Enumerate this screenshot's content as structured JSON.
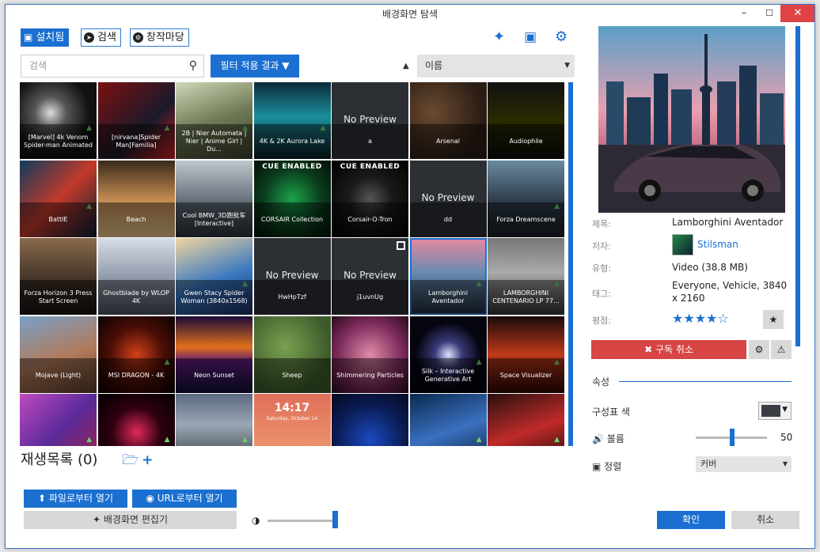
{
  "window": {
    "title": "배경화면 탐색",
    "minimize": "–",
    "maximize": "☐",
    "close": "✕"
  },
  "tabs": [
    {
      "label": "설치됨",
      "icon": "save-icon",
      "active": true
    },
    {
      "label": "검색",
      "icon": "compass-icon",
      "active": false
    },
    {
      "label": "창작마당",
      "icon": "steam-icon",
      "active": false
    }
  ],
  "search": {
    "placeholder": "검색"
  },
  "filter": {
    "label": "필터 적용 결과"
  },
  "sort": {
    "value": "이름"
  },
  "wallpapers": [
    {
      "title": "[Marvel] 4k Venom Spider-man Animated",
      "bg": "radial-gradient(circle at 40% 40%,#ddd 0,#555 25%,#111 60%)",
      "trophy": true
    },
    {
      "title": "[nirvana]Spider Man[Familia]",
      "bg": "linear-gradient(135deg,#7a1010,#1a1a2a 60%,#c22)",
      "trophy": true
    },
    {
      "title": "2B | Nier Automata | Nier | Anime Girl | Du...",
      "bg": "linear-gradient(160deg,#cfd8b8,#6e7a55 50%,#3a3f2b)",
      "trophy": true
    },
    {
      "title": "4K & 2K Aurora Lake",
      "bg": "linear-gradient(180deg,#0c2a3a,#1b8f9c 45%,#0a1c24)",
      "trophy": true
    },
    {
      "title": "a",
      "nopreview": "No Preview",
      "bg": "#2c2f33"
    },
    {
      "title": "Arsenal",
      "bg": "radial-gradient(circle at 30% 40%,#6a4a30,#2a1d14 70%)"
    },
    {
      "title": "Audiophile",
      "bg": "linear-gradient(180deg,#111,#2a2a00 50%,#0b0b0b)"
    },
    {
      "title": "BattlE",
      "bg": "linear-gradient(135deg,#0e3b5c,#c23a2a 50%,#0a1e33)",
      "trophy": true
    },
    {
      "title": "Beach",
      "bg": "linear-gradient(180deg,#3a2a1a,#c08a50 50%,#e2c08a)"
    },
    {
      "title": "Cool BMW_3D跑批车 [Interactive]",
      "bg": "linear-gradient(180deg,#bfc6cc,#5a6470 60%,#2d3238)"
    },
    {
      "title": "CORSAIR Collection",
      "cue": "CUE ENABLED",
      "bg": "radial-gradient(circle,#1aa34a 0,#0b3a1c 55%,#021006)"
    },
    {
      "title": "Corsair-O-Tron",
      "cue": "CUE ENABLED",
      "bg": "radial-gradient(circle,#555 0,#1a1a1a 40%,#000)"
    },
    {
      "title": "dd",
      "nopreview": "No Preview",
      "bg": "#2c2f33"
    },
    {
      "title": "Forza Dreamscene",
      "bg": "linear-gradient(180deg,#6a8aa0,#2c3a48 55%,#1a1e24)",
      "trophy": true
    },
    {
      "title": "Forza Horizon 3 Press Start Screen",
      "bg": "linear-gradient(180deg,#8a6a4a,#3a2e26 60%,#151210)"
    },
    {
      "title": "Ghostblade by WLOP 4K",
      "bg": "linear-gradient(180deg,#d6dde6,#8d96a6 55%,#4a4f5c)"
    },
    {
      "title": "Gwen Stacy Spider Woman (3840x1568)",
      "bg": "linear-gradient(160deg,#f0d6a0,#3a78c0 55%,#1a2a5a)",
      "trophy": true
    },
    {
      "title": "HwHpTzf",
      "nopreview": "No Preview",
      "bg": "#2c2f33"
    },
    {
      "title": "j1uvnUg",
      "nopreview": "No Preview",
      "bg": "#2c2f33",
      "checkbox": true
    },
    {
      "title": "Lamborghini Aventador",
      "bg": "linear-gradient(180deg,#e68aa0,#6a8ab0 45%,#1e2a3a)",
      "trophy": true,
      "selected": true
    },
    {
      "title": "LAMBORGHINI CENTENARIO LP 77...",
      "bg": "linear-gradient(180deg,#777,#aaa 45%,#333)",
      "trophy": true
    },
    {
      "title": "Mojave (Light)",
      "bg": "linear-gradient(160deg,#7aa0c8,#b07a5a 55%,#5a3a2a)"
    },
    {
      "title": "MSI DRAGON - 4K",
      "bg": "radial-gradient(circle,#d0401a 0,#4a0e06 50%,#0a0202)",
      "trophy": true
    },
    {
      "title": "Neon Sunset",
      "bg": "linear-gradient(180deg,#1a0a3a,#e0701a 40%,#5a1a7a 60%,#101030)"
    },
    {
      "title": "Sheep",
      "bg": "radial-gradient(circle at 40% 40%,#7aa050,#3c5a2a 70%)"
    },
    {
      "title": "Shimmering Particles",
      "bg": "radial-gradient(circle at 50% 50%,#e08aa8,#7a2a5a 60%,#2a0a1a)"
    },
    {
      "title": "Silk – Interactive Generative Art",
      "bg": "radial-gradient(circle,#e0e0ff 0,#3a3a7a 25%,#05050f 60%)",
      "trophy": true
    },
    {
      "title": "Space Visualizer",
      "bg": "linear-gradient(180deg,#1a0a0a,#c03a1a 50%,#2a0505)",
      "trophy": true
    },
    {
      "title": "",
      "bg": "linear-gradient(135deg,#c04ac0,#5a2a9a 50%,#a02040)",
      "trophy": true
    },
    {
      "title": "",
      "bg": "radial-gradient(circle,#e02a5a 0,#300010 45%,#000)",
      "trophy": true
    },
    {
      "title": "",
      "bg": "linear-gradient(180deg,#5a6a80,#9aa6b4 40%,#2a3038)",
      "trophy": true
    },
    {
      "title": "",
      "clock": "14:17",
      "date": "Saturday, October 14",
      "bg": "linear-gradient(180deg,#e0705a,#f0a070)"
    },
    {
      "title": "",
      "bg": "radial-gradient(circle at 50% 60%,#1a4ac0,#0a1a50 60%,#050a20)"
    },
    {
      "title": "",
      "bg": "linear-gradient(160deg,#0a2a50,#3a70c0 50%,#0a1a30)",
      "trophy": true
    },
    {
      "title": "",
      "bg": "linear-gradient(160deg,#2a1010,#c02a2a 50%,#100505)",
      "trophy": true
    }
  ],
  "playlist": {
    "label": "재생목록 (0)",
    "folder_icon": "folder-open-icon",
    "add_icon": "plus-icon"
  },
  "buttons": {
    "open_file": "파일로부터 열기",
    "open_url": "URL로부터 열기",
    "editor": "배경화면 편집기",
    "ok": "확인",
    "cancel": "취소"
  },
  "details": {
    "title_label": "제목:",
    "title_value": "Lamborghini Aventador",
    "author_label": "저자:",
    "author_value": "Stilsman",
    "type_label": "유형:",
    "type_value": "Video (38.8 MB)",
    "tags_label": "태그:",
    "tags_value": "Everyone, Vehicle, 3840 x 2160",
    "rating_label": "평점:",
    "rating_value": "★★★★☆",
    "unsubscribe": "구독 취소"
  },
  "properties": {
    "header": "속성",
    "scheme_color_label": "구성표 색",
    "scheme_color": "#3a3d44",
    "volume_label": "볼륨",
    "volume_value": "50",
    "alignment_label": "정렬",
    "alignment_value": "커버"
  }
}
